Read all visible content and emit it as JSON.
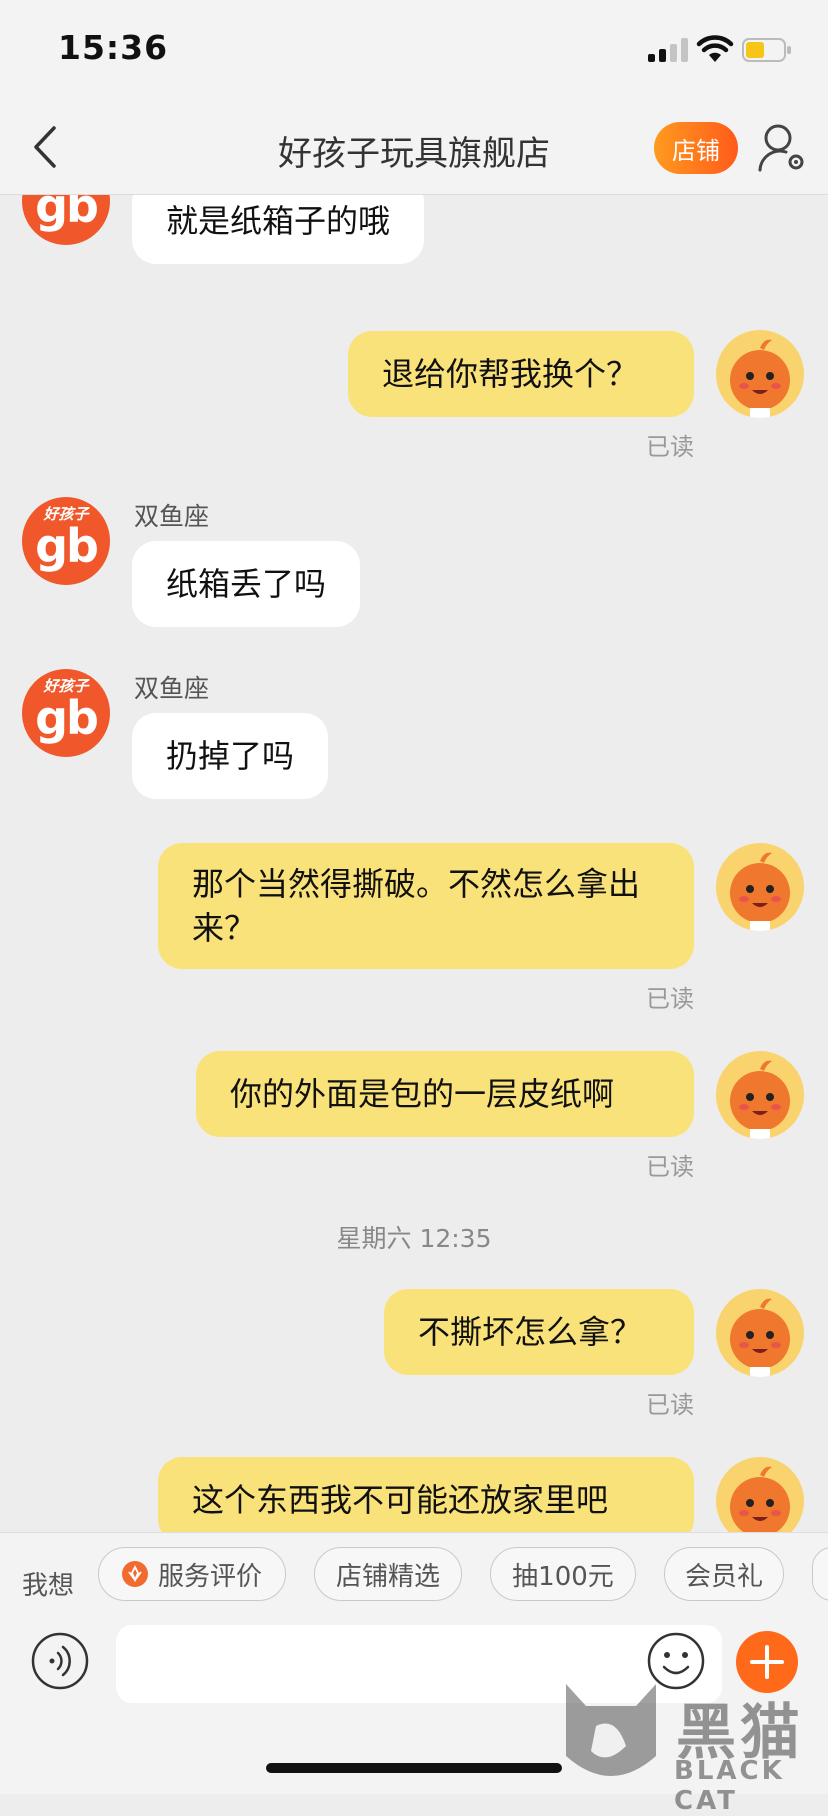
{
  "status": {
    "time": "15:36"
  },
  "header": {
    "title": "好孩子玩具旗舰店",
    "shop_button": "店铺",
    "back_icon": "chevron-left-icon",
    "user_icon": "user-settings-icon"
  },
  "shop_avatar": {
    "top_text": "好孩子",
    "logo_text": "gb"
  },
  "messages": [
    {
      "side": "in",
      "text": "就是纸箱子的哦"
    },
    {
      "side": "out",
      "text": "退给你帮我换个？",
      "status": "已读"
    },
    {
      "side": "in",
      "sender": "双鱼座",
      "text": "纸箱丢了吗"
    },
    {
      "side": "in",
      "sender": "双鱼座",
      "text": "扔掉了吗"
    },
    {
      "side": "out",
      "text": "那个当然得撕破。不然怎么拿出来？",
      "status": "已读"
    },
    {
      "side": "out",
      "text": "你的外面是包的一层皮纸啊",
      "status": "已读"
    },
    {
      "side": "out",
      "text": "不撕坏怎么拿？",
      "status": "已读"
    },
    {
      "side": "out",
      "text": "这个东西我不可能还放家里吧"
    }
  ],
  "timestamp": "星期六 12:35",
  "quick_bar": {
    "label": "我想",
    "chips": [
      "服务评价",
      "店铺精选",
      "抽100元",
      "会员礼"
    ]
  },
  "composer": {
    "input_value": "",
    "voice_icon": "voice-icon",
    "emoji_icon": "emoji-icon",
    "plus_icon": "plus-icon"
  },
  "watermark": {
    "title": "黑猫",
    "subtitle": "BLACK CAT"
  },
  "colors": {
    "accent": "#ff6a1a",
    "outgoing_bubble": "#fae27a",
    "incoming_bubble": "#ffffff",
    "background": "#ededed"
  }
}
